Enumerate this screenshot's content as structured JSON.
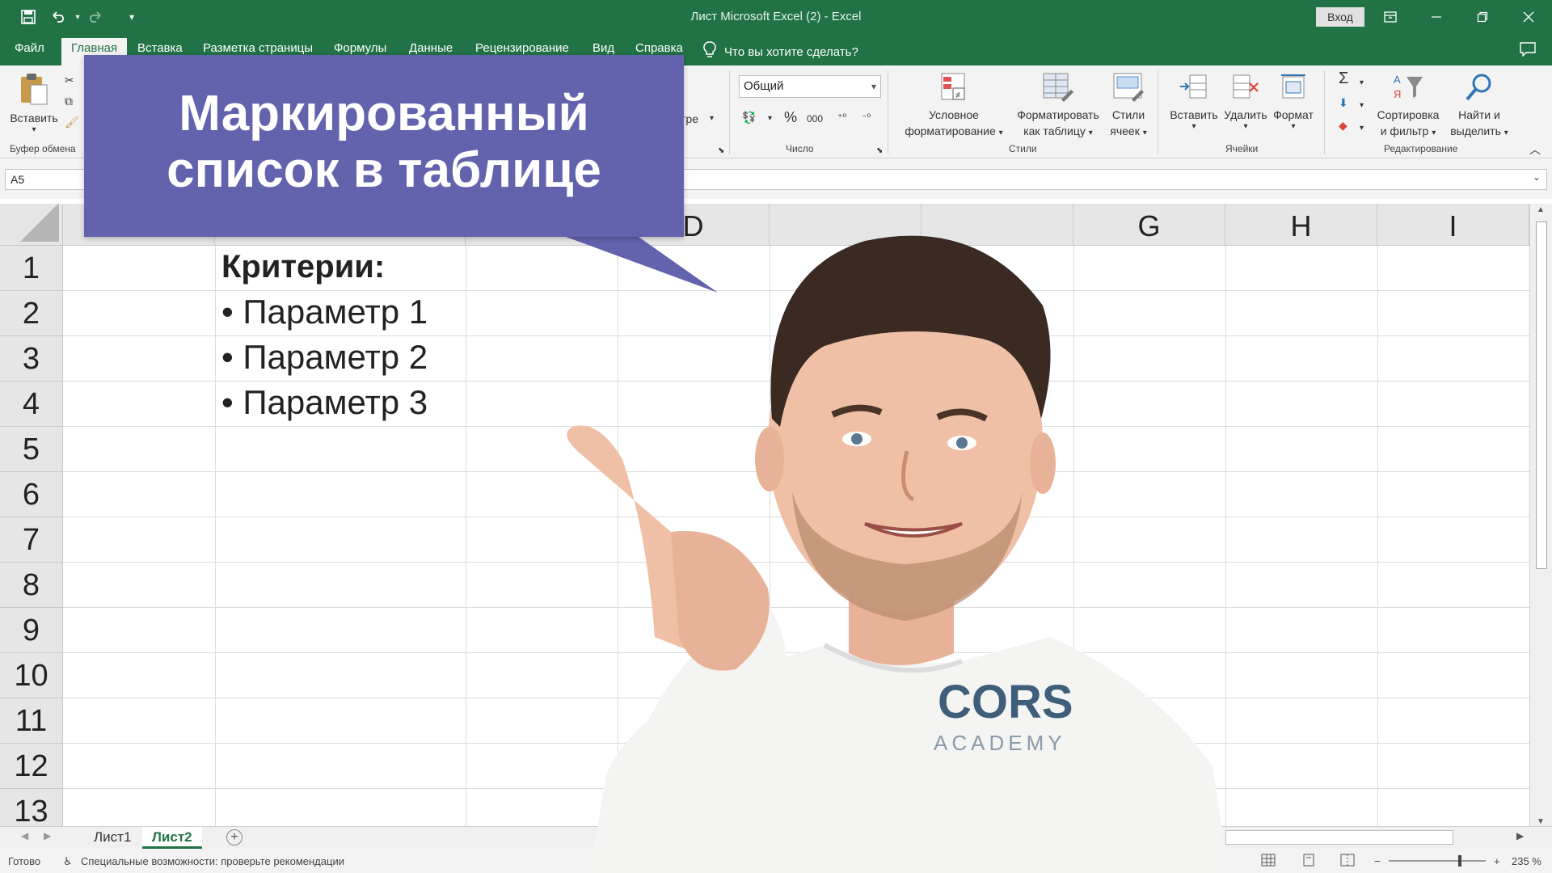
{
  "titlebar": {
    "document_title": "Лист Microsoft Excel (2)  -  Excel",
    "signin_label": "Вход",
    "icons": [
      "save-icon",
      "undo-icon",
      "redo-icon",
      "customize-qat-icon",
      "ribbon-display-icon",
      "minimize-icon",
      "restore-icon",
      "close-icon"
    ]
  },
  "ribbon_tabs": {
    "file": "Файл",
    "home": "Главная",
    "insert": "Вставка",
    "page_layout": "Разметка страницы",
    "formulas": "Формулы",
    "data": "Данные",
    "review": "Рецензирование",
    "view": "Вид",
    "help": "Справка",
    "tell_me": "Что вы хотите сделать?"
  },
  "ribbon": {
    "paste_label": "Вставить",
    "clipboard_group": "Буфер обмена",
    "alignment_partial": "тре",
    "number_format": "Общий",
    "percent_symbol": "%",
    "thousands_symbol": "000",
    "number_group": "Число",
    "conditional_formatting": [
      "Условное",
      "форматирование"
    ],
    "format_as_table": [
      "Форматировать",
      "как таблицу"
    ],
    "cell_styles": [
      "Стили",
      "ячеек"
    ],
    "styles_group": "Стили",
    "insert_cells": "Вставить",
    "delete_cells": "Удалить",
    "format_cells": "Формат",
    "cells_group": "Ячейки",
    "sort_filter": [
      "Сортировка",
      "и фильтр"
    ],
    "find_select": [
      "Найти и",
      "выделить"
    ],
    "editing_group": "Редактирование"
  },
  "formula_bar": {
    "name_box": "A5",
    "formula": ""
  },
  "grid": {
    "columns": [
      "D",
      "G",
      "H",
      "I"
    ],
    "rows": [
      "1",
      "2",
      "3",
      "4",
      "5",
      "6",
      "7",
      "8",
      "9",
      "10",
      "11",
      "12",
      "13"
    ],
    "cells": {
      "B1": "Критерии:",
      "B2": "• Параметр 1",
      "B3": "• Параметр 2",
      "B4": "• Параметр 3"
    }
  },
  "sheets": {
    "tab1": "Лист1",
    "tab2": "Лист2",
    "active": "Лист2"
  },
  "status": {
    "ready": "Готово",
    "accessibility": "Специальные возможности: проверьте рекомендации",
    "zoom": "235 %"
  },
  "overlay": {
    "line1": "Маркированный",
    "line2": "список в таблице",
    "shirt_logo": "CORS",
    "shirt_sub": "ACADEMY"
  },
  "colors": {
    "excel_green": "#217346",
    "callout_purple": "#6262ad"
  }
}
